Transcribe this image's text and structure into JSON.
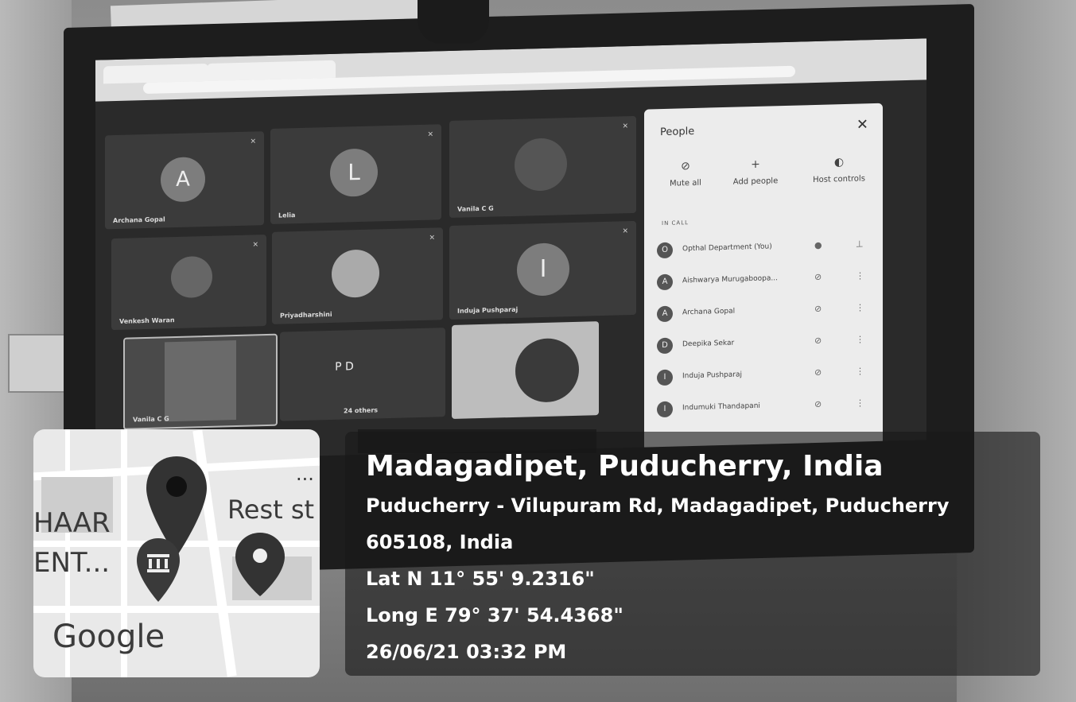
{
  "meet": {
    "panel_title": "People",
    "actions": [
      "Mute all",
      "Add people",
      "Host controls"
    ],
    "in_call_label": "IN CALL",
    "participants": [
      {
        "initial": "O",
        "name": "Opthal Department (You)"
      },
      {
        "initial": "A",
        "name": "Aishwarya Murugaboopa..."
      },
      {
        "initial": "A",
        "name": "Archana Gopal"
      },
      {
        "initial": "D",
        "name": "Deepika Sekar"
      },
      {
        "initial": "I",
        "name": "Induja Pushparaj"
      },
      {
        "initial": "I",
        "name": "Indumuki Thandapani"
      }
    ],
    "tiles": [
      {
        "initial": "A",
        "name": "Archana Gopal"
      },
      {
        "initial": "L",
        "name": "Lelia"
      },
      {
        "initial": "",
        "name": "Vanila C G"
      },
      {
        "initial": "",
        "name": "Venkesh Waran"
      },
      {
        "initial": "",
        "name": "Priyadharshini"
      },
      {
        "initial": "I",
        "name": "Induja Pushparaj"
      },
      {
        "initial": "",
        "name": "Vanila C G"
      },
      {
        "initial": "P D",
        "name": "24 others"
      }
    ]
  },
  "map": {
    "labels": [
      "HAAR",
      "ENT...",
      "Rest st",
      "..."
    ],
    "brand": "Google"
  },
  "geotag": {
    "place": "Madagadipet, Puducherry, India",
    "address_line1": "Puducherry - Vilupuram Rd, Madagadipet, Puducherry",
    "address_line2": "605108, India",
    "latitude": "Lat N 11° 55' 9.2316\"",
    "longitude": "Long E 79° 37' 54.4368\"",
    "datetime": "26/06/21 03:32 PM"
  }
}
